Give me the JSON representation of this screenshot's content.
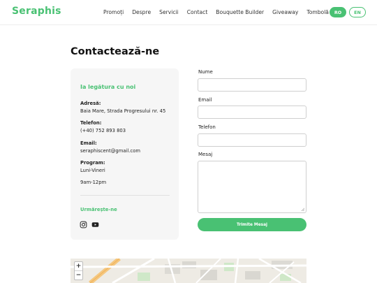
{
  "header": {
    "brand": "Seraphis",
    "nav": [
      "Promoți",
      "Despre",
      "Servicii",
      "Contact",
      "Bouquette Builder",
      "Giveaway",
      "Tombolă"
    ],
    "languages": {
      "ro": "RO",
      "en": "EN"
    }
  },
  "page": {
    "title": "Contactează-ne"
  },
  "info": {
    "heading": "Ia legătura cu noi",
    "address_label": "Adresă:",
    "address_value": "Baia Mare, Strada Progresului nr. 45",
    "phone_label": "Telefon:",
    "phone_value": "(+40) 752 893 803",
    "email_label": "Email:",
    "email_value": "seraphiscent@gmail.com",
    "program_label": "Program:",
    "program_days": "Luni-Vineri",
    "program_hours": "9am-12pm",
    "follow_heading": "Urmărește-ne",
    "social": [
      "instagram-icon",
      "youtube-icon"
    ]
  },
  "form": {
    "name_label": "Nume",
    "email_label": "Email",
    "phone_label": "Telefon",
    "message_label": "Mesaj",
    "submit_label": "Trimite Mesaj"
  },
  "map": {
    "zoom_in": "+",
    "zoom_out": "−"
  },
  "colors": {
    "accent": "#49c173",
    "card_bg": "#f6f6f6"
  }
}
